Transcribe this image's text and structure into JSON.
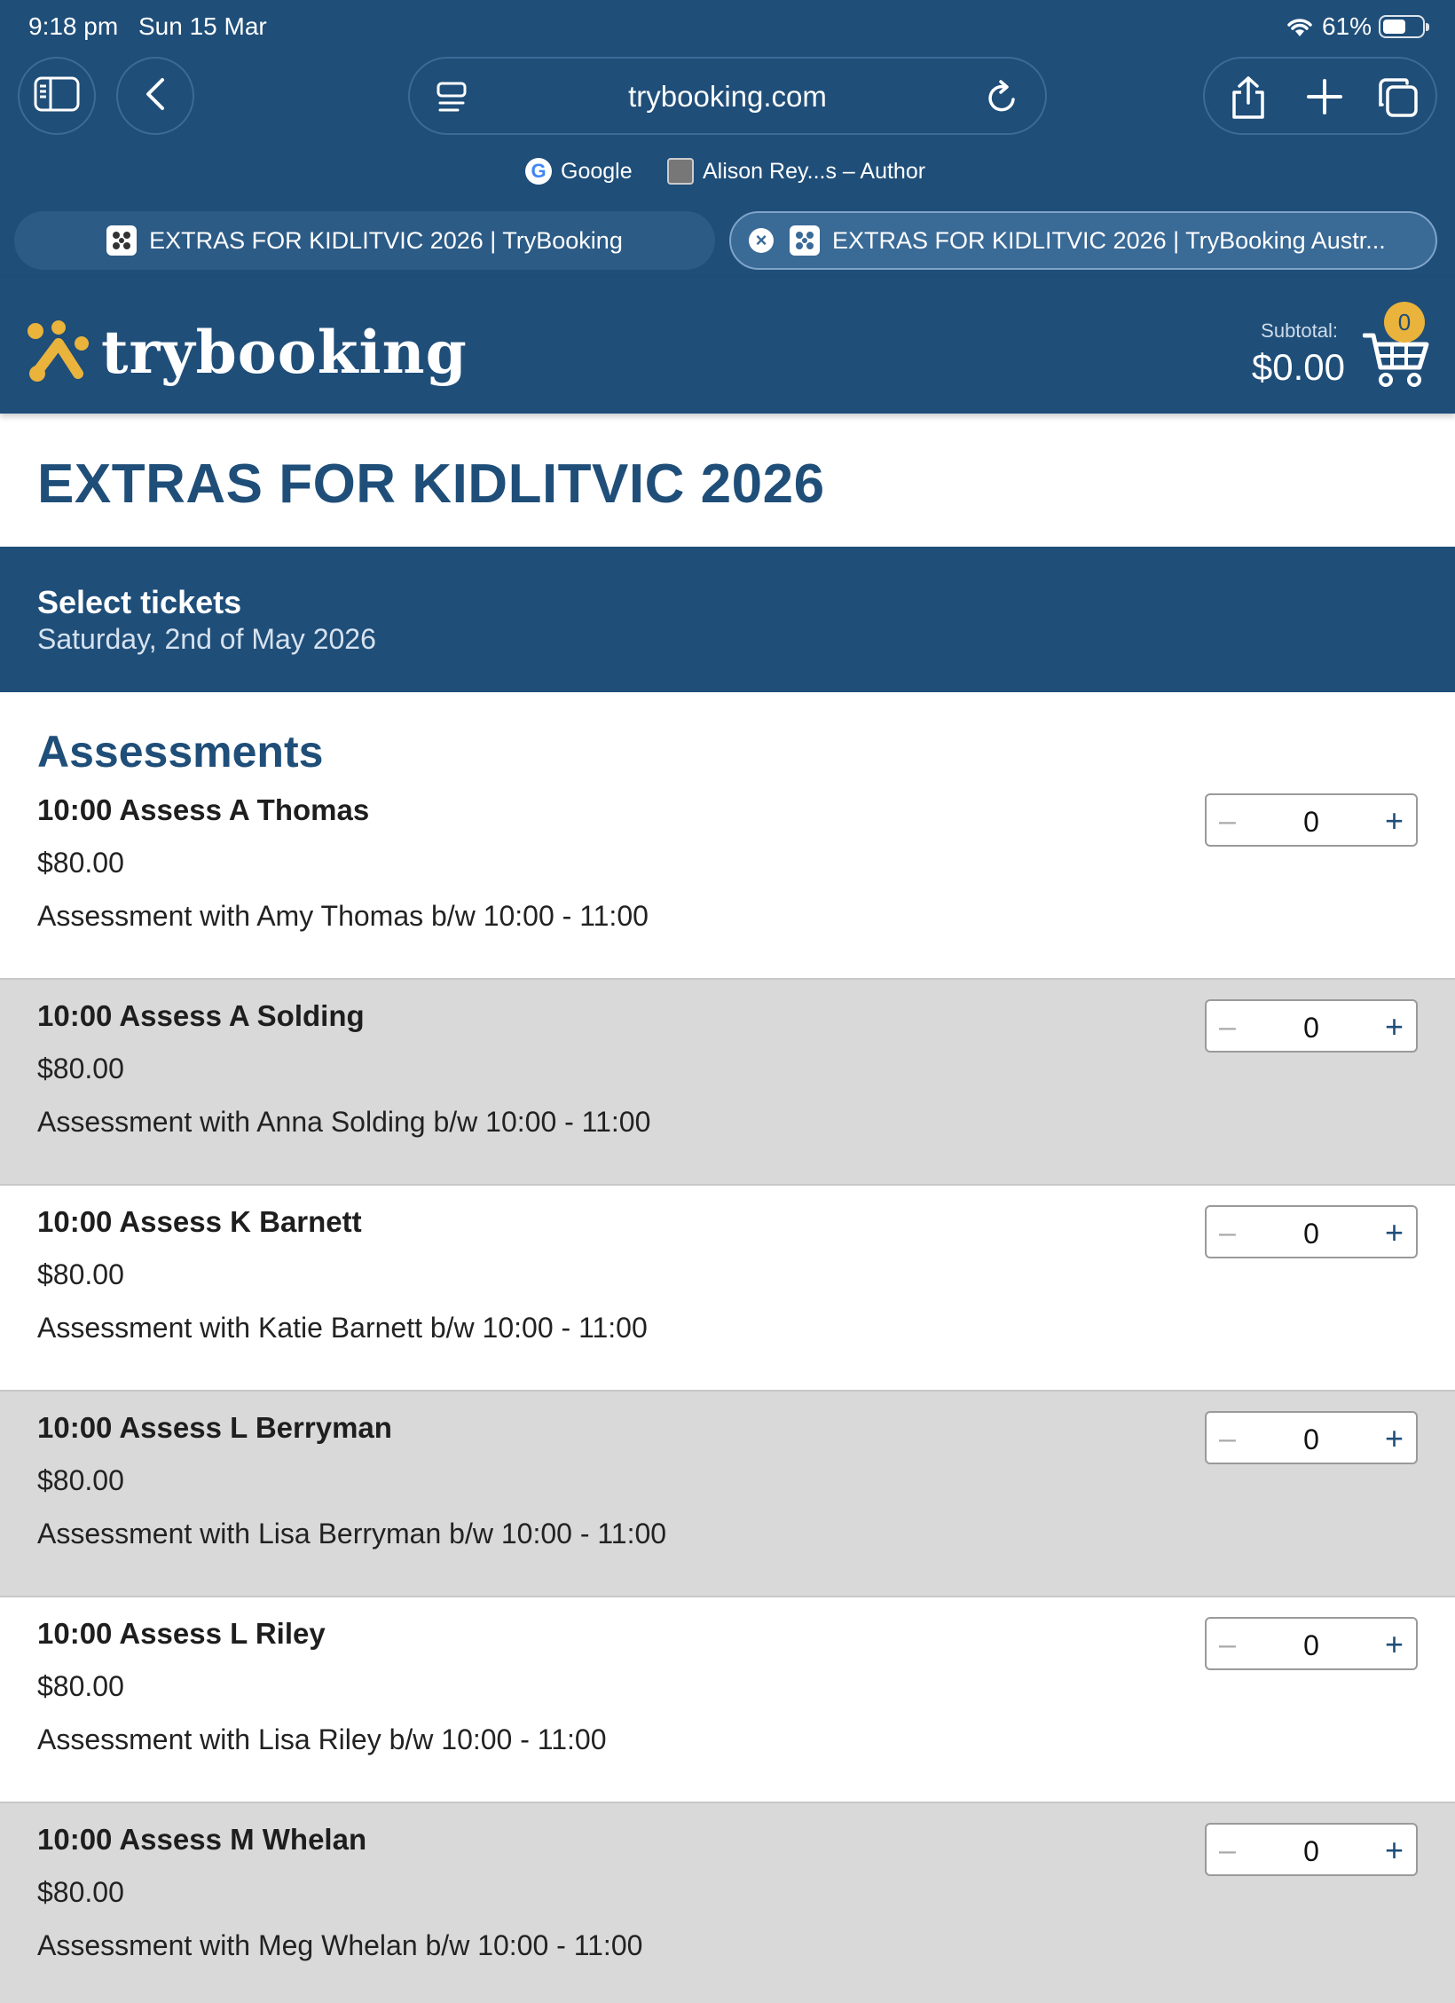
{
  "status_bar": {
    "time": "9:18 pm",
    "date": "Sun 15 Mar",
    "battery": "61%",
    "battery_level": 0.61
  },
  "browser": {
    "url": "trybooking.com",
    "favorites": [
      {
        "label": "Google"
      },
      {
        "label": "Alison Rey...s – Author"
      }
    ],
    "tabs": [
      {
        "label": "EXTRAS FOR KIDLITVIC 2026 | TryBooking"
      },
      {
        "label": "EXTRAS FOR KIDLITVIC 2026 | TryBooking Austr..."
      }
    ]
  },
  "header": {
    "logo_text": "trybooking",
    "subtotal_label": "Subtotal:",
    "subtotal_value": "$0.00",
    "cart_count": "0"
  },
  "event": {
    "title": "EXTRAS FOR KIDLITVIC 2026",
    "select_heading": "Select tickets",
    "date": "Saturday, 2nd of May 2026",
    "section": "Assessments"
  },
  "tickets": [
    {
      "name": "10:00 Assess A Thomas",
      "price": "$80.00",
      "desc": "Assessment with Amy Thomas b/w 10:00 - 11:00",
      "qty": "0",
      "minus": "–",
      "plus": "+"
    },
    {
      "name": "10:00 Assess A Solding",
      "price": "$80.00",
      "desc": "Assessment with Anna Solding b/w 10:00 - 11:00",
      "qty": "0",
      "minus": "–",
      "plus": "+"
    },
    {
      "name": "10:00 Assess K Barnett",
      "price": "$80.00",
      "desc": "Assessment with Katie Barnett b/w 10:00 - 11:00",
      "qty": "0",
      "minus": "–",
      "plus": "+"
    },
    {
      "name": "10:00 Assess L Berryman",
      "price": "$80.00",
      "desc": "Assessment with Lisa Berryman b/w 10:00 - 11:00",
      "qty": "0",
      "minus": "–",
      "plus": "+"
    },
    {
      "name": "10:00 Assess L Riley",
      "price": "$80.00",
      "desc": "Assessment with Lisa Riley b/w 10:00 - 11:00",
      "qty": "0",
      "minus": "–",
      "plus": "+"
    },
    {
      "name": "10:00 Assess M Whelan",
      "price": "$80.00",
      "desc": "Assessment with Meg Whelan b/w 10:00 - 11:00",
      "qty": "0",
      "minus": "–",
      "plus": "+"
    }
  ],
  "colors": {
    "brand": "#1f4e79",
    "accent": "#e9b33c",
    "alt_row": "#d9d9d9"
  }
}
